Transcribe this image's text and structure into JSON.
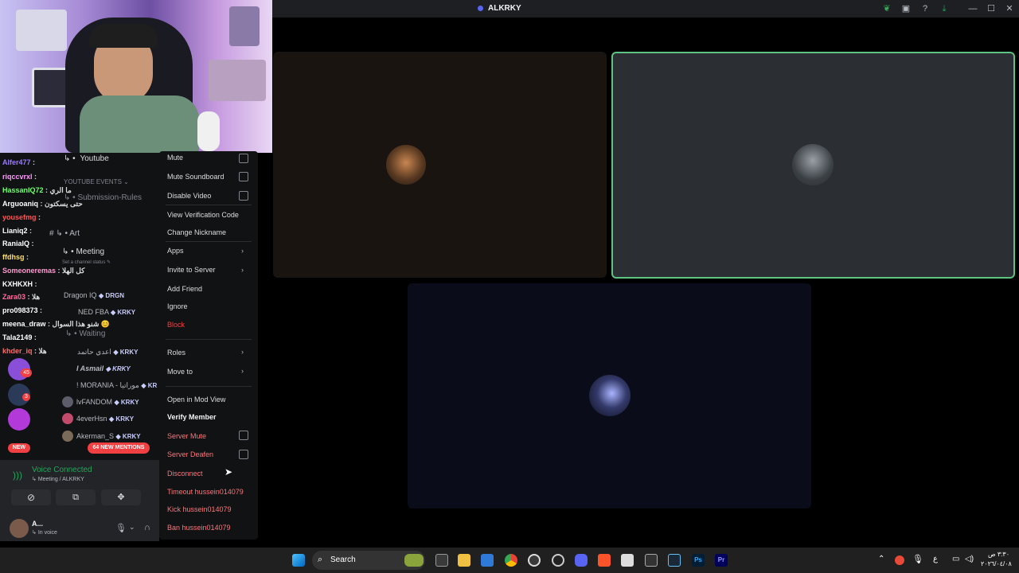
{
  "window": {
    "title": "ALKRKY"
  },
  "stream_chat": {
    "lines": [
      {
        "user": "Alfer477",
        "msg": ":",
        "color": "#9b7bff"
      },
      {
        "user": "riqccvrxl",
        "msg": ":",
        "color": "#ff9bff"
      },
      {
        "user": "HassanIQ72",
        "msg": ": ما الري",
        "color": "#6bff6b"
      },
      {
        "user": "Arguoaniq",
        "msg": ": حتى يسكتون",
        "color": "#ffffff"
      },
      {
        "user": "yousefmg",
        "msg": ":",
        "color": "#ff5555"
      },
      {
        "user": "Lianiq2",
        "msg": ":",
        "color": "#ffffff"
      },
      {
        "user": "RaniaIQ",
        "msg": ":",
        "color": "#ffffff"
      },
      {
        "user": "ffdhsg",
        "msg": ":",
        "color": "#ffe066"
      },
      {
        "user": "Someoneremas",
        "msg": ": كل الهلا",
        "color": "#ff9bd0"
      },
      {
        "user": "KXHKXH",
        "msg": ":",
        "color": "#ffffff"
      },
      {
        "user": "Zara03",
        "msg": ": هلا",
        "color": "#ff6b9b"
      },
      {
        "user": "pro098373",
        "msg": ":",
        "color": "#ffffff"
      },
      {
        "user": "meena_draw",
        "msg": ": شنو هذا السوال 😊",
        "color": "#ffffff"
      },
      {
        "user": "Tala2149",
        "msg": ":",
        "color": "#ffffff"
      },
      {
        "user": "khder_iq",
        "msg": ": هلا",
        "color": "#ff6b6b"
      }
    ]
  },
  "sidebar": {
    "channels": {
      "youtube": "Youtube",
      "youtube_events": "YOUTUBE EVENTS",
      "submission_rules": "Submission-Rules",
      "art": "Art",
      "meeting": "Meeting",
      "set_status": "Set a channel status",
      "waiting": "Waiting"
    },
    "members": [
      {
        "name": "Dragon IQ",
        "tag": "DRGN"
      },
      {
        "name": "NED FBA",
        "tag": "KRKY"
      },
      {
        "name": "اعدي حاتمد",
        "tag": "KRKY"
      },
      {
        "name": "I Asmail",
        "tag": "KRKY"
      },
      {
        "name": "! MORANIA - موراتيا",
        "tag": "KR"
      },
      {
        "name": "lvFANDOM",
        "tag": "KRKY"
      },
      {
        "name": "4everHsn",
        "tag": "KRKY"
      },
      {
        "name": "Akerman_S",
        "tag": "KRKY"
      }
    ],
    "server_badges": {
      "badge1": "45",
      "badge2": "3",
      "new": "NEW"
    },
    "mentions_pill": "64 NEW MENTIONS",
    "voice": {
      "status": "Voice Connected",
      "location": "Meeting / ALKRKY"
    },
    "user": {
      "name": "A...",
      "status": "In voice"
    }
  },
  "context_menu": {
    "mute": "Mute",
    "mute_soundboard": "Mute Soundboard",
    "disable_video": "Disable Video",
    "view_verification_code": "View Verification Code",
    "change_nickname": "Change Nickname",
    "apps": "Apps",
    "invite_to_server": "Invite to Server",
    "add_friend": "Add Friend",
    "ignore": "Ignore",
    "block": "Block",
    "roles": "Roles",
    "move_to": "Move to",
    "open_in_mod_view": "Open in Mod View",
    "verify_member": "Verify Member",
    "server_mute": "Server Mute",
    "server_deafen": "Server Deafen",
    "disconnect": "Disconnect",
    "timeout": "Timeout hussein014079",
    "kick": "Kick hussein014079",
    "ban": "Ban hussein014079"
  },
  "taskbar": {
    "search": "Search",
    "lang": "ع",
    "time": "٣:٣٠ ص",
    "date": "٢٠٢٦/٠٤/٠٨"
  },
  "colors": {
    "accent": "#5865f2",
    "danger": "#f23f42",
    "speaking": "#23a559",
    "voice_green": "#23a559"
  }
}
